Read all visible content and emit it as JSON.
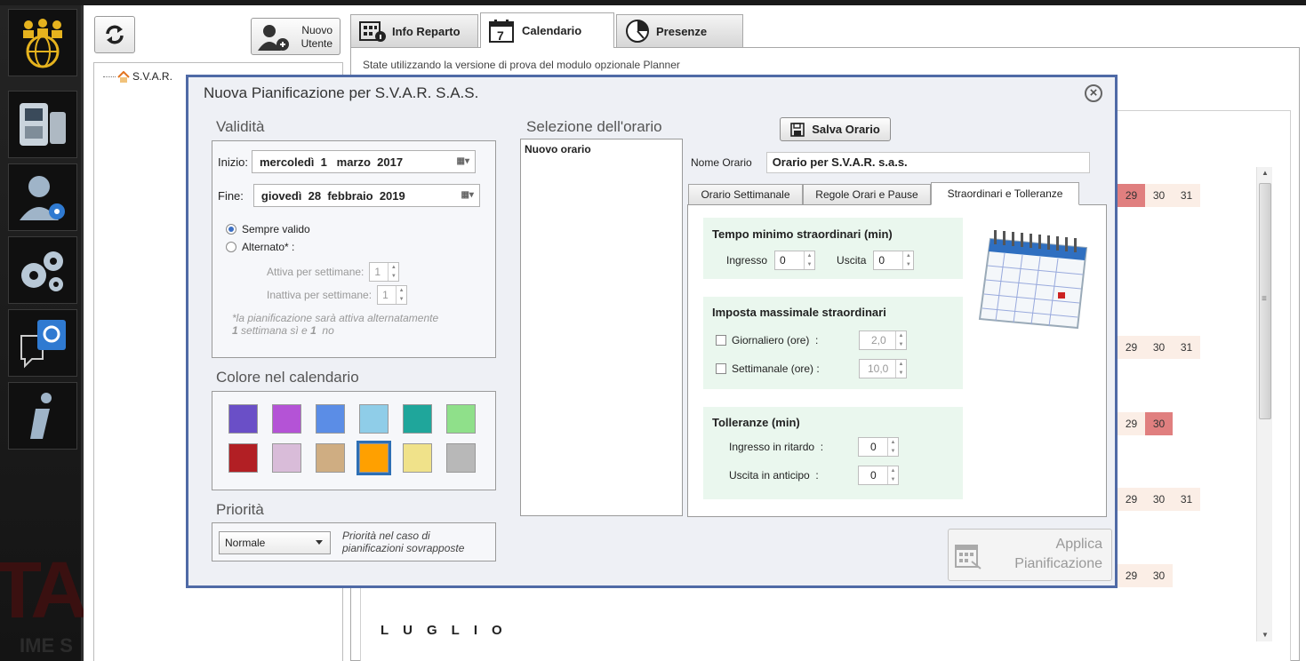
{
  "left_panel": {
    "new_user_line1": "Nuovo",
    "new_user_line2": "Utente",
    "tree_root": "S.V.A.R."
  },
  "tabs": [
    {
      "label": "Info Reparto"
    },
    {
      "label": "Calendario",
      "calendar_number": "7"
    },
    {
      "label": "Presenze"
    }
  ],
  "trial_message": "State utilizzando la versione di prova del modulo opzionale Planner",
  "calendar": {
    "rows": [
      [
        "29",
        "30",
        "31"
      ],
      [
        "29",
        "30",
        "31"
      ],
      [
        "29",
        "30"
      ],
      [
        "29",
        "30",
        "31"
      ],
      [
        "29",
        "30"
      ]
    ],
    "month": "LUGLIO"
  },
  "dialog": {
    "title": "Nuova Pianificazione per S.V.A.R. S.A.S.",
    "validita": {
      "title": "Validità",
      "start_label": "Inizio:",
      "start_value": "mercoledì  1   marzo  2017",
      "end_label": "Fine:",
      "end_value": "giovedì  28  febbraio  2019",
      "always_valid": "Sempre valido",
      "alternate": "Alternato* :",
      "active_weeks_label": "Attiva per settimane:",
      "active_weeks_value": "1",
      "inactive_weeks_label": "Inattiva per settimane:",
      "inactive_weeks_value": "1",
      "note_line1": "*la pianificazione sarà attiva alternatamente",
      "note_line2_a": "1",
      "note_line2_b": " settimana sì e ",
      "note_line2_c": "1",
      "note_line2_d": "  no"
    },
    "colore": {
      "title": "Colore nel calendario",
      "swatches": [
        "#6a4fc7",
        "#b453d6",
        "#5b8de6",
        "#8fcde8",
        "#1fa69b",
        "#8fe08a",
        "#b21f24",
        "#d9bcd9",
        "#cfad82",
        "#ffa000",
        "#f0e28a",
        "#b8b8b8"
      ],
      "selected_index": 9
    },
    "priorita": {
      "title": "Priorità",
      "value": "Normale",
      "note_line1": "Priorità nel caso di",
      "note_line2": "pianificazioni sovrapposte"
    },
    "selezione": {
      "title": "Selezione dell'orario",
      "items": [
        "Nuovo orario"
      ]
    },
    "save_button": "Salva Orario",
    "schedule_name_label": "Nome Orario",
    "schedule_name_value": "Orario per S.V.A.R. s.a.s.",
    "inner_tabs": [
      "Orario Settimanale",
      "Regole Orari e Pause",
      "Straordinari e Tolleranze"
    ],
    "straordinari": {
      "min_title": "Tempo minimo straordinari (min)",
      "ingresso_label": "Ingresso",
      "ingresso_value": "0",
      "uscita_label": "Uscita",
      "uscita_value": "0",
      "max_title": "Imposta massimale straordinari",
      "daily_label": "Giornaliero (ore)  :",
      "daily_value": "2,0",
      "weekly_label": "Settimanale (ore) :",
      "weekly_value": "10,0",
      "toll_title": "Tolleranze (min)",
      "late_label": "Ingresso in ritardo  :",
      "late_value": "0",
      "early_label": "Uscita in anticipo  :",
      "early_value": "0"
    },
    "apply_line1": "Applica",
    "apply_line2": "Pianificazione"
  }
}
